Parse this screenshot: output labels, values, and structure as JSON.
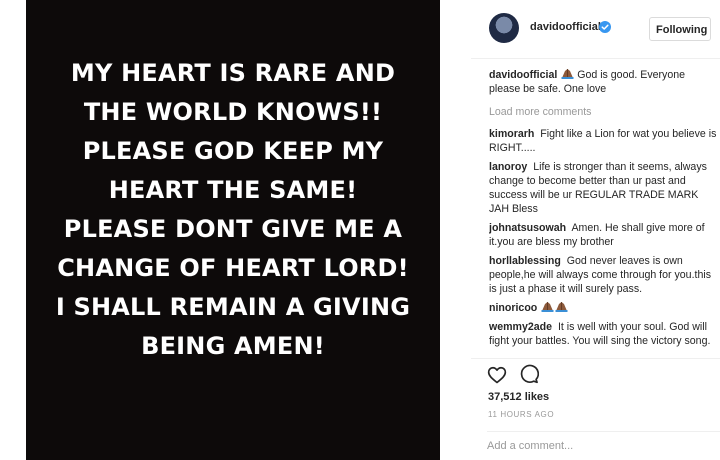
{
  "post": {
    "image_lines": [
      "MY HEART IS RARE AND",
      "THE WORLD KNOWS!!",
      "PLEASE GOD KEEP MY",
      "HEART THE SAME!",
      "PLEASE DONT GIVE ME A",
      "CHANGE OF HEART LORD!",
      "I SHALL REMAIN A GIVING",
      "BEING AMEN!"
    ]
  },
  "header": {
    "username": "davidoofficial",
    "follow_label": "Following",
    "icons": [
      "avatar",
      "verified-badge-icon"
    ],
    "accent_color": "#3897f0"
  },
  "caption": {
    "username": "davidoofficial",
    "text": "God is good. Everyone please be safe. One love"
  },
  "load_more_label": "Load more comments",
  "comments": [
    {
      "username": "kimorarh",
      "text": "Fight like a Lion for wat you believe is RIGHT....."
    },
    {
      "username": "lanoroy",
      "text": "Life is stronger than it seems, always change to become better than ur past and success will be ur REGULAR TRADE MARK JAH Bless"
    },
    {
      "username": "johnatsusowah",
      "text": "Amen. He shall give more of it.you are bless my brother"
    },
    {
      "username": "horllablessing",
      "text": "God never leaves is own people,he will always come through for you.this is just a phase it will surely pass."
    },
    {
      "username": "ninoricoo",
      "text": ""
    },
    {
      "username": "wemmy2ade",
      "text": "It is well with your soul. God will fight your battles. You will sing the victory song."
    }
  ],
  "actions": {
    "icons": [
      "heart-icon",
      "comment-bubble-icon"
    ]
  },
  "likes": "37,512 likes",
  "timestamp": "11 HOURS AGO",
  "comment_input": {
    "placeholder": "Add a comment..."
  }
}
